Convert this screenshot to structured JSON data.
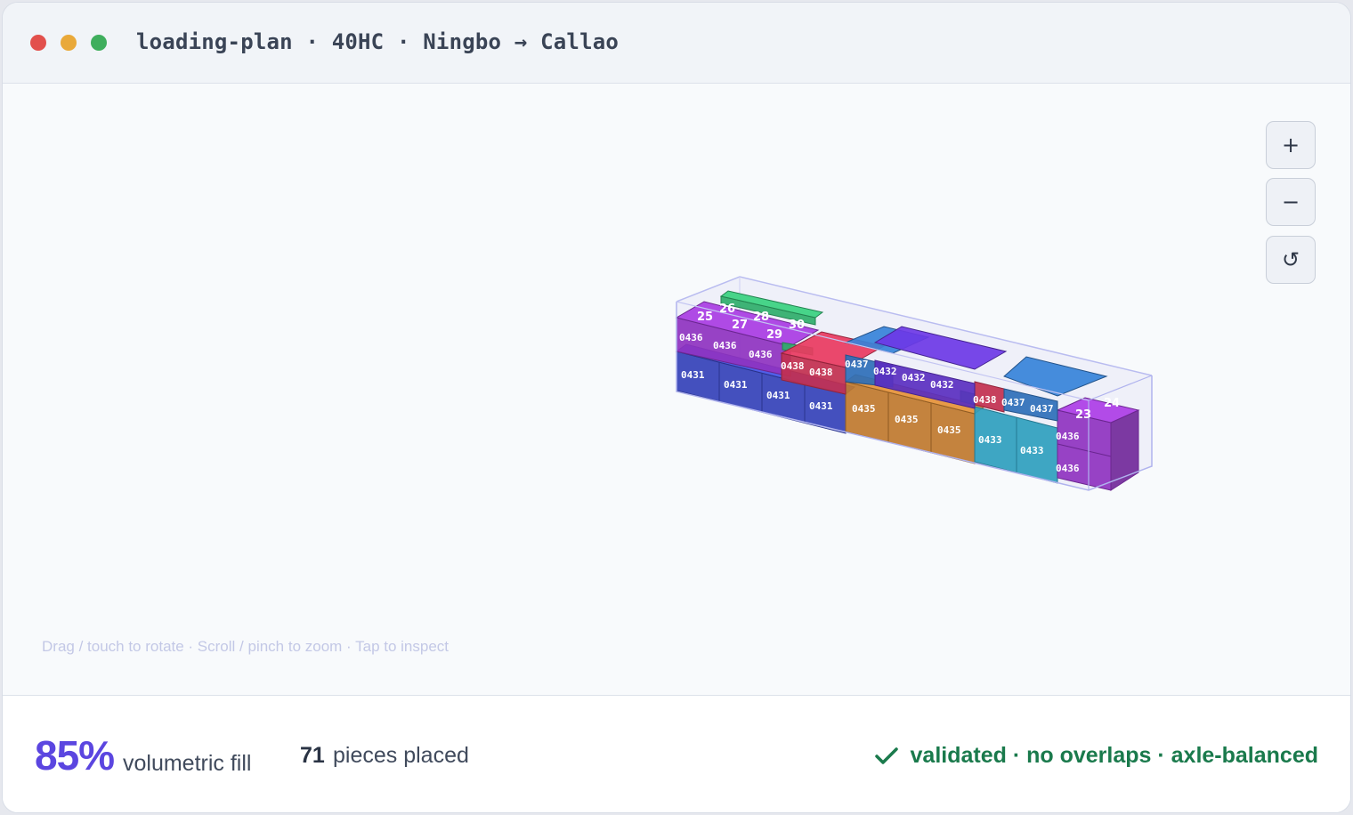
{
  "window": {
    "title": "loading-plan · 40HC · Ningbo → Callao"
  },
  "viewport": {
    "hint": "Drag / touch to rotate · Scroll / pinch to zoom · Tap to inspect",
    "controls": [
      {
        "name": "zoom-in",
        "icon": "plus-icon",
        "glyph": "+"
      },
      {
        "name": "zoom-out",
        "icon": "minus-icon",
        "glyph": "−"
      },
      {
        "name": "reset-view",
        "icon": "rotate-ccw-icon",
        "glyph": "↺"
      }
    ],
    "colors": {
      "0431": "#3542b8",
      "0435": "#c07a2e",
      "0433": "#2f9fbe",
      "0436": "#8f33c0",
      "0438": "#c2304f",
      "0437": "#2e6fb8",
      "0432": "#5a2fc0",
      "green": "#2fae6a"
    },
    "labels": {
      "0431": "0431",
      "0432": "0432",
      "0433": "0433",
      "0435": "0435",
      "0436": "0436",
      "0437": "0437",
      "0438": "0438",
      "n23": "23",
      "n24": "24",
      "n25": "25",
      "n26": "26",
      "n27": "27",
      "n28": "28",
      "n29": "29",
      "n30": "30"
    }
  },
  "footer": {
    "fill_percent": "85%",
    "fill_label": "volumetric fill",
    "pieces_count": "71",
    "pieces_label": "pieces placed",
    "status": "validated · no overlaps · axle-balanced",
    "status_color": "#1a7a4c"
  }
}
